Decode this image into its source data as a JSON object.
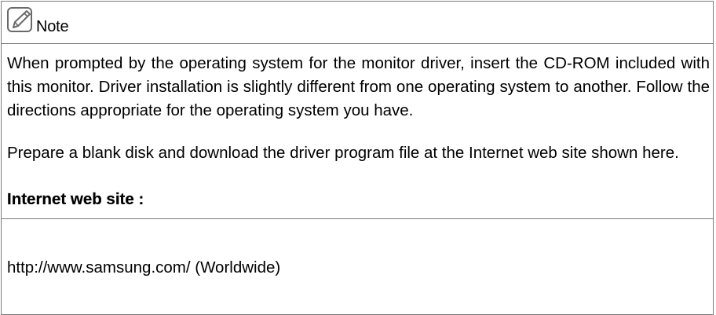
{
  "note": {
    "title": "Note",
    "icon": "pencil-note-icon",
    "paragraph1": "When prompted by the operating system for the monitor driver, insert the CD-ROM included with this monitor. Driver installation is slightly different from one operating system to another. Follow the directions appropriate for the operating system you have.",
    "paragraph2": "Prepare a blank disk and download the driver program file at the Internet web site shown here.",
    "website_label": "Internet web site :",
    "website_url": "http://www.samsung.com/ (Worldwide)"
  }
}
